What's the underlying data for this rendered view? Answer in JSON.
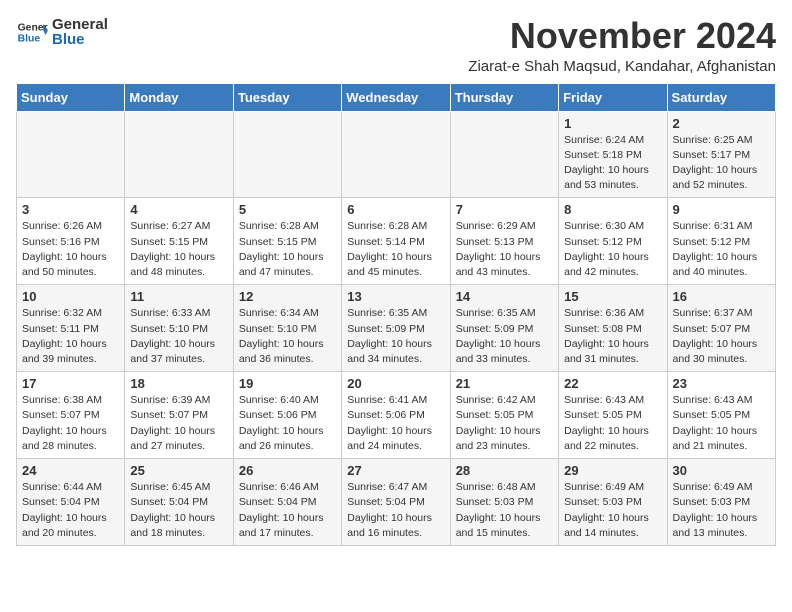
{
  "header": {
    "logo_general": "General",
    "logo_blue": "Blue",
    "month_title": "November 2024",
    "subtitle": "Ziarat-e Shah Maqsud, Kandahar, Afghanistan"
  },
  "weekdays": [
    "Sunday",
    "Monday",
    "Tuesday",
    "Wednesday",
    "Thursday",
    "Friday",
    "Saturday"
  ],
  "weeks": [
    [
      {
        "day": "",
        "info": ""
      },
      {
        "day": "",
        "info": ""
      },
      {
        "day": "",
        "info": ""
      },
      {
        "day": "",
        "info": ""
      },
      {
        "day": "",
        "info": ""
      },
      {
        "day": "1",
        "info": "Sunrise: 6:24 AM\nSunset: 5:18 PM\nDaylight: 10 hours\nand 53 minutes."
      },
      {
        "day": "2",
        "info": "Sunrise: 6:25 AM\nSunset: 5:17 PM\nDaylight: 10 hours\nand 52 minutes."
      }
    ],
    [
      {
        "day": "3",
        "info": "Sunrise: 6:26 AM\nSunset: 5:16 PM\nDaylight: 10 hours\nand 50 minutes."
      },
      {
        "day": "4",
        "info": "Sunrise: 6:27 AM\nSunset: 5:15 PM\nDaylight: 10 hours\nand 48 minutes."
      },
      {
        "day": "5",
        "info": "Sunrise: 6:28 AM\nSunset: 5:15 PM\nDaylight: 10 hours\nand 47 minutes."
      },
      {
        "day": "6",
        "info": "Sunrise: 6:28 AM\nSunset: 5:14 PM\nDaylight: 10 hours\nand 45 minutes."
      },
      {
        "day": "7",
        "info": "Sunrise: 6:29 AM\nSunset: 5:13 PM\nDaylight: 10 hours\nand 43 minutes."
      },
      {
        "day": "8",
        "info": "Sunrise: 6:30 AM\nSunset: 5:12 PM\nDaylight: 10 hours\nand 42 minutes."
      },
      {
        "day": "9",
        "info": "Sunrise: 6:31 AM\nSunset: 5:12 PM\nDaylight: 10 hours\nand 40 minutes."
      }
    ],
    [
      {
        "day": "10",
        "info": "Sunrise: 6:32 AM\nSunset: 5:11 PM\nDaylight: 10 hours\nand 39 minutes."
      },
      {
        "day": "11",
        "info": "Sunrise: 6:33 AM\nSunset: 5:10 PM\nDaylight: 10 hours\nand 37 minutes."
      },
      {
        "day": "12",
        "info": "Sunrise: 6:34 AM\nSunset: 5:10 PM\nDaylight: 10 hours\nand 36 minutes."
      },
      {
        "day": "13",
        "info": "Sunrise: 6:35 AM\nSunset: 5:09 PM\nDaylight: 10 hours\nand 34 minutes."
      },
      {
        "day": "14",
        "info": "Sunrise: 6:35 AM\nSunset: 5:09 PM\nDaylight: 10 hours\nand 33 minutes."
      },
      {
        "day": "15",
        "info": "Sunrise: 6:36 AM\nSunset: 5:08 PM\nDaylight: 10 hours\nand 31 minutes."
      },
      {
        "day": "16",
        "info": "Sunrise: 6:37 AM\nSunset: 5:07 PM\nDaylight: 10 hours\nand 30 minutes."
      }
    ],
    [
      {
        "day": "17",
        "info": "Sunrise: 6:38 AM\nSunset: 5:07 PM\nDaylight: 10 hours\nand 28 minutes."
      },
      {
        "day": "18",
        "info": "Sunrise: 6:39 AM\nSunset: 5:07 PM\nDaylight: 10 hours\nand 27 minutes."
      },
      {
        "day": "19",
        "info": "Sunrise: 6:40 AM\nSunset: 5:06 PM\nDaylight: 10 hours\nand 26 minutes."
      },
      {
        "day": "20",
        "info": "Sunrise: 6:41 AM\nSunset: 5:06 PM\nDaylight: 10 hours\nand 24 minutes."
      },
      {
        "day": "21",
        "info": "Sunrise: 6:42 AM\nSunset: 5:05 PM\nDaylight: 10 hours\nand 23 minutes."
      },
      {
        "day": "22",
        "info": "Sunrise: 6:43 AM\nSunset: 5:05 PM\nDaylight: 10 hours\nand 22 minutes."
      },
      {
        "day": "23",
        "info": "Sunrise: 6:43 AM\nSunset: 5:05 PM\nDaylight: 10 hours\nand 21 minutes."
      }
    ],
    [
      {
        "day": "24",
        "info": "Sunrise: 6:44 AM\nSunset: 5:04 PM\nDaylight: 10 hours\nand 20 minutes."
      },
      {
        "day": "25",
        "info": "Sunrise: 6:45 AM\nSunset: 5:04 PM\nDaylight: 10 hours\nand 18 minutes."
      },
      {
        "day": "26",
        "info": "Sunrise: 6:46 AM\nSunset: 5:04 PM\nDaylight: 10 hours\nand 17 minutes."
      },
      {
        "day": "27",
        "info": "Sunrise: 6:47 AM\nSunset: 5:04 PM\nDaylight: 10 hours\nand 16 minutes."
      },
      {
        "day": "28",
        "info": "Sunrise: 6:48 AM\nSunset: 5:03 PM\nDaylight: 10 hours\nand 15 minutes."
      },
      {
        "day": "29",
        "info": "Sunrise: 6:49 AM\nSunset: 5:03 PM\nDaylight: 10 hours\nand 14 minutes."
      },
      {
        "day": "30",
        "info": "Sunrise: 6:49 AM\nSunset: 5:03 PM\nDaylight: 10 hours\nand 13 minutes."
      }
    ]
  ]
}
